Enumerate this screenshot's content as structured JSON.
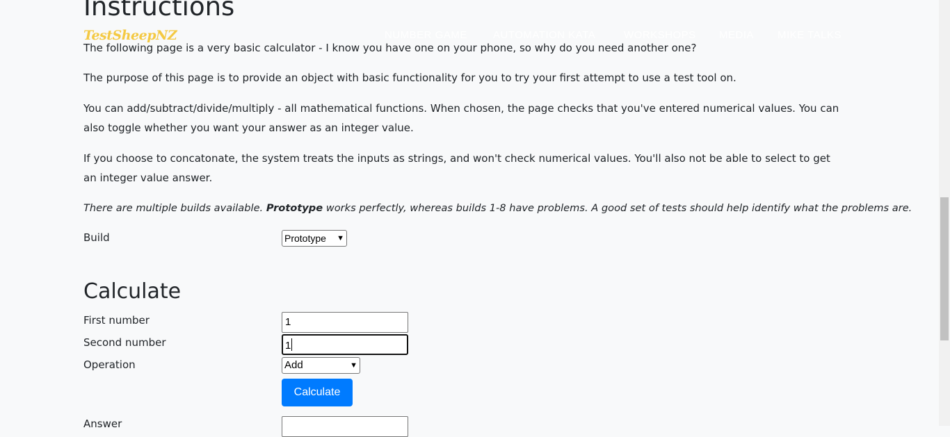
{
  "navbar": {
    "logo": "TestSheepNZ",
    "links": [
      "NUMBER GAME",
      "AUTOMATION KATA",
      "WORKSHOPS",
      "MEDIA",
      "MIKE TALKS"
    ]
  },
  "instructions": {
    "heading": "Instructions",
    "p1": "The following page is a very basic calculator - I know you have one on your phone, so why do you need another one?",
    "p2": "The purpose of this page is to provide an object with basic functionality for you to try your first attempt to use a test tool on.",
    "p3": "You can add/subtract/divide/multiply - all mathematical functions. When chosen, the page checks that you've entered numerical values. You can also toggle whether you want your answer as an integer value.",
    "p4": "If you choose to concatonate, the system treats the inputs as strings, and won't check numerical values. You'll also not be able to select to get an integer value answer.",
    "p5_pre": "There are multiple builds available. ",
    "p5_bold": "Prototype",
    "p5_post": " works perfectly, whereas builds 1-8 have problems. A good set of tests should help identify what the problems are."
  },
  "build": {
    "label": "Build",
    "selected": "Prototype"
  },
  "calculate": {
    "heading": "Calculate",
    "first_label": "First number",
    "first_value": "1",
    "second_label": "Second number",
    "second_value": "1",
    "operation_label": "Operation",
    "operation_selected": "Add",
    "button_label": "Calculate",
    "answer_label": "Answer",
    "answer_value": ""
  },
  "icons": {
    "dropdown": "chevron-down-icon"
  }
}
